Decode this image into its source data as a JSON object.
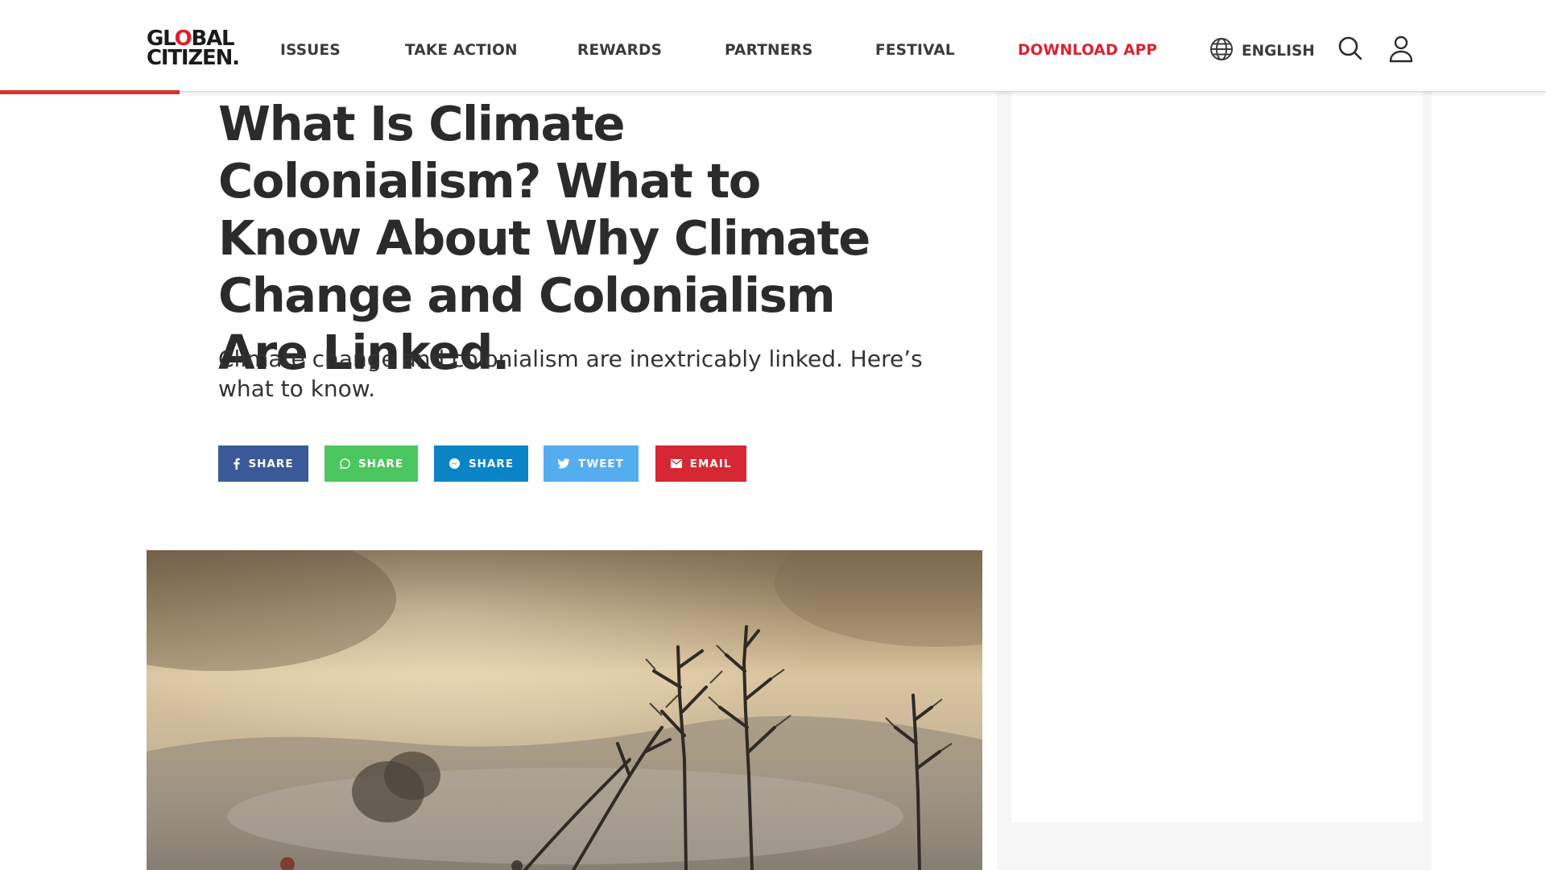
{
  "header": {
    "logo": {
      "line1_pre": "GL",
      "line1_accent": "O",
      "line1_post": "BAL",
      "line2": "CITIZEN."
    },
    "nav": [
      {
        "label": "ISSUES",
        "icon": null
      },
      {
        "label": "TAKE ACTION",
        "icon": null
      },
      {
        "label": "REWARDS",
        "icon": null
      },
      {
        "label": "PARTNERS",
        "icon": null
      },
      {
        "label": "FESTIVAL",
        "icon": null
      },
      {
        "label": "DOWNLOAD APP",
        "icon": null
      }
    ],
    "language": {
      "label": "ENGLISH",
      "icon": "globe-icon"
    },
    "search_icon": "search-icon",
    "account_icon": "user-icon",
    "reading_progress": 0.116
  },
  "article": {
    "headline": "What Is Climate Colonialism? What to Know About Why Climate Change and Colonialism Are Linked.",
    "dek": "Climate change and colonialism are inextricably linked. Here’s what to know.",
    "share_buttons": [
      {
        "label": "SHARE",
        "icon": "facebook-icon",
        "color": "#3b5998"
      },
      {
        "label": "SHARE",
        "icon": "whatsapp-icon",
        "color": "#4cc65e"
      },
      {
        "label": "SHARE",
        "icon": "messenger-icon",
        "color": "#0a84c6"
      },
      {
        "label": "TWEET",
        "icon": "twitter-icon",
        "color": "#55acee"
      },
      {
        "label": "EMAIL",
        "icon": "envelope-icon",
        "color": "#d62734"
      }
    ]
  },
  "colors": {
    "accent_red": "#dc2130",
    "text_dark": "#2b2b2b",
    "progress_red": "#d63232",
    "sidebar_bg": "#f6f6f6"
  }
}
